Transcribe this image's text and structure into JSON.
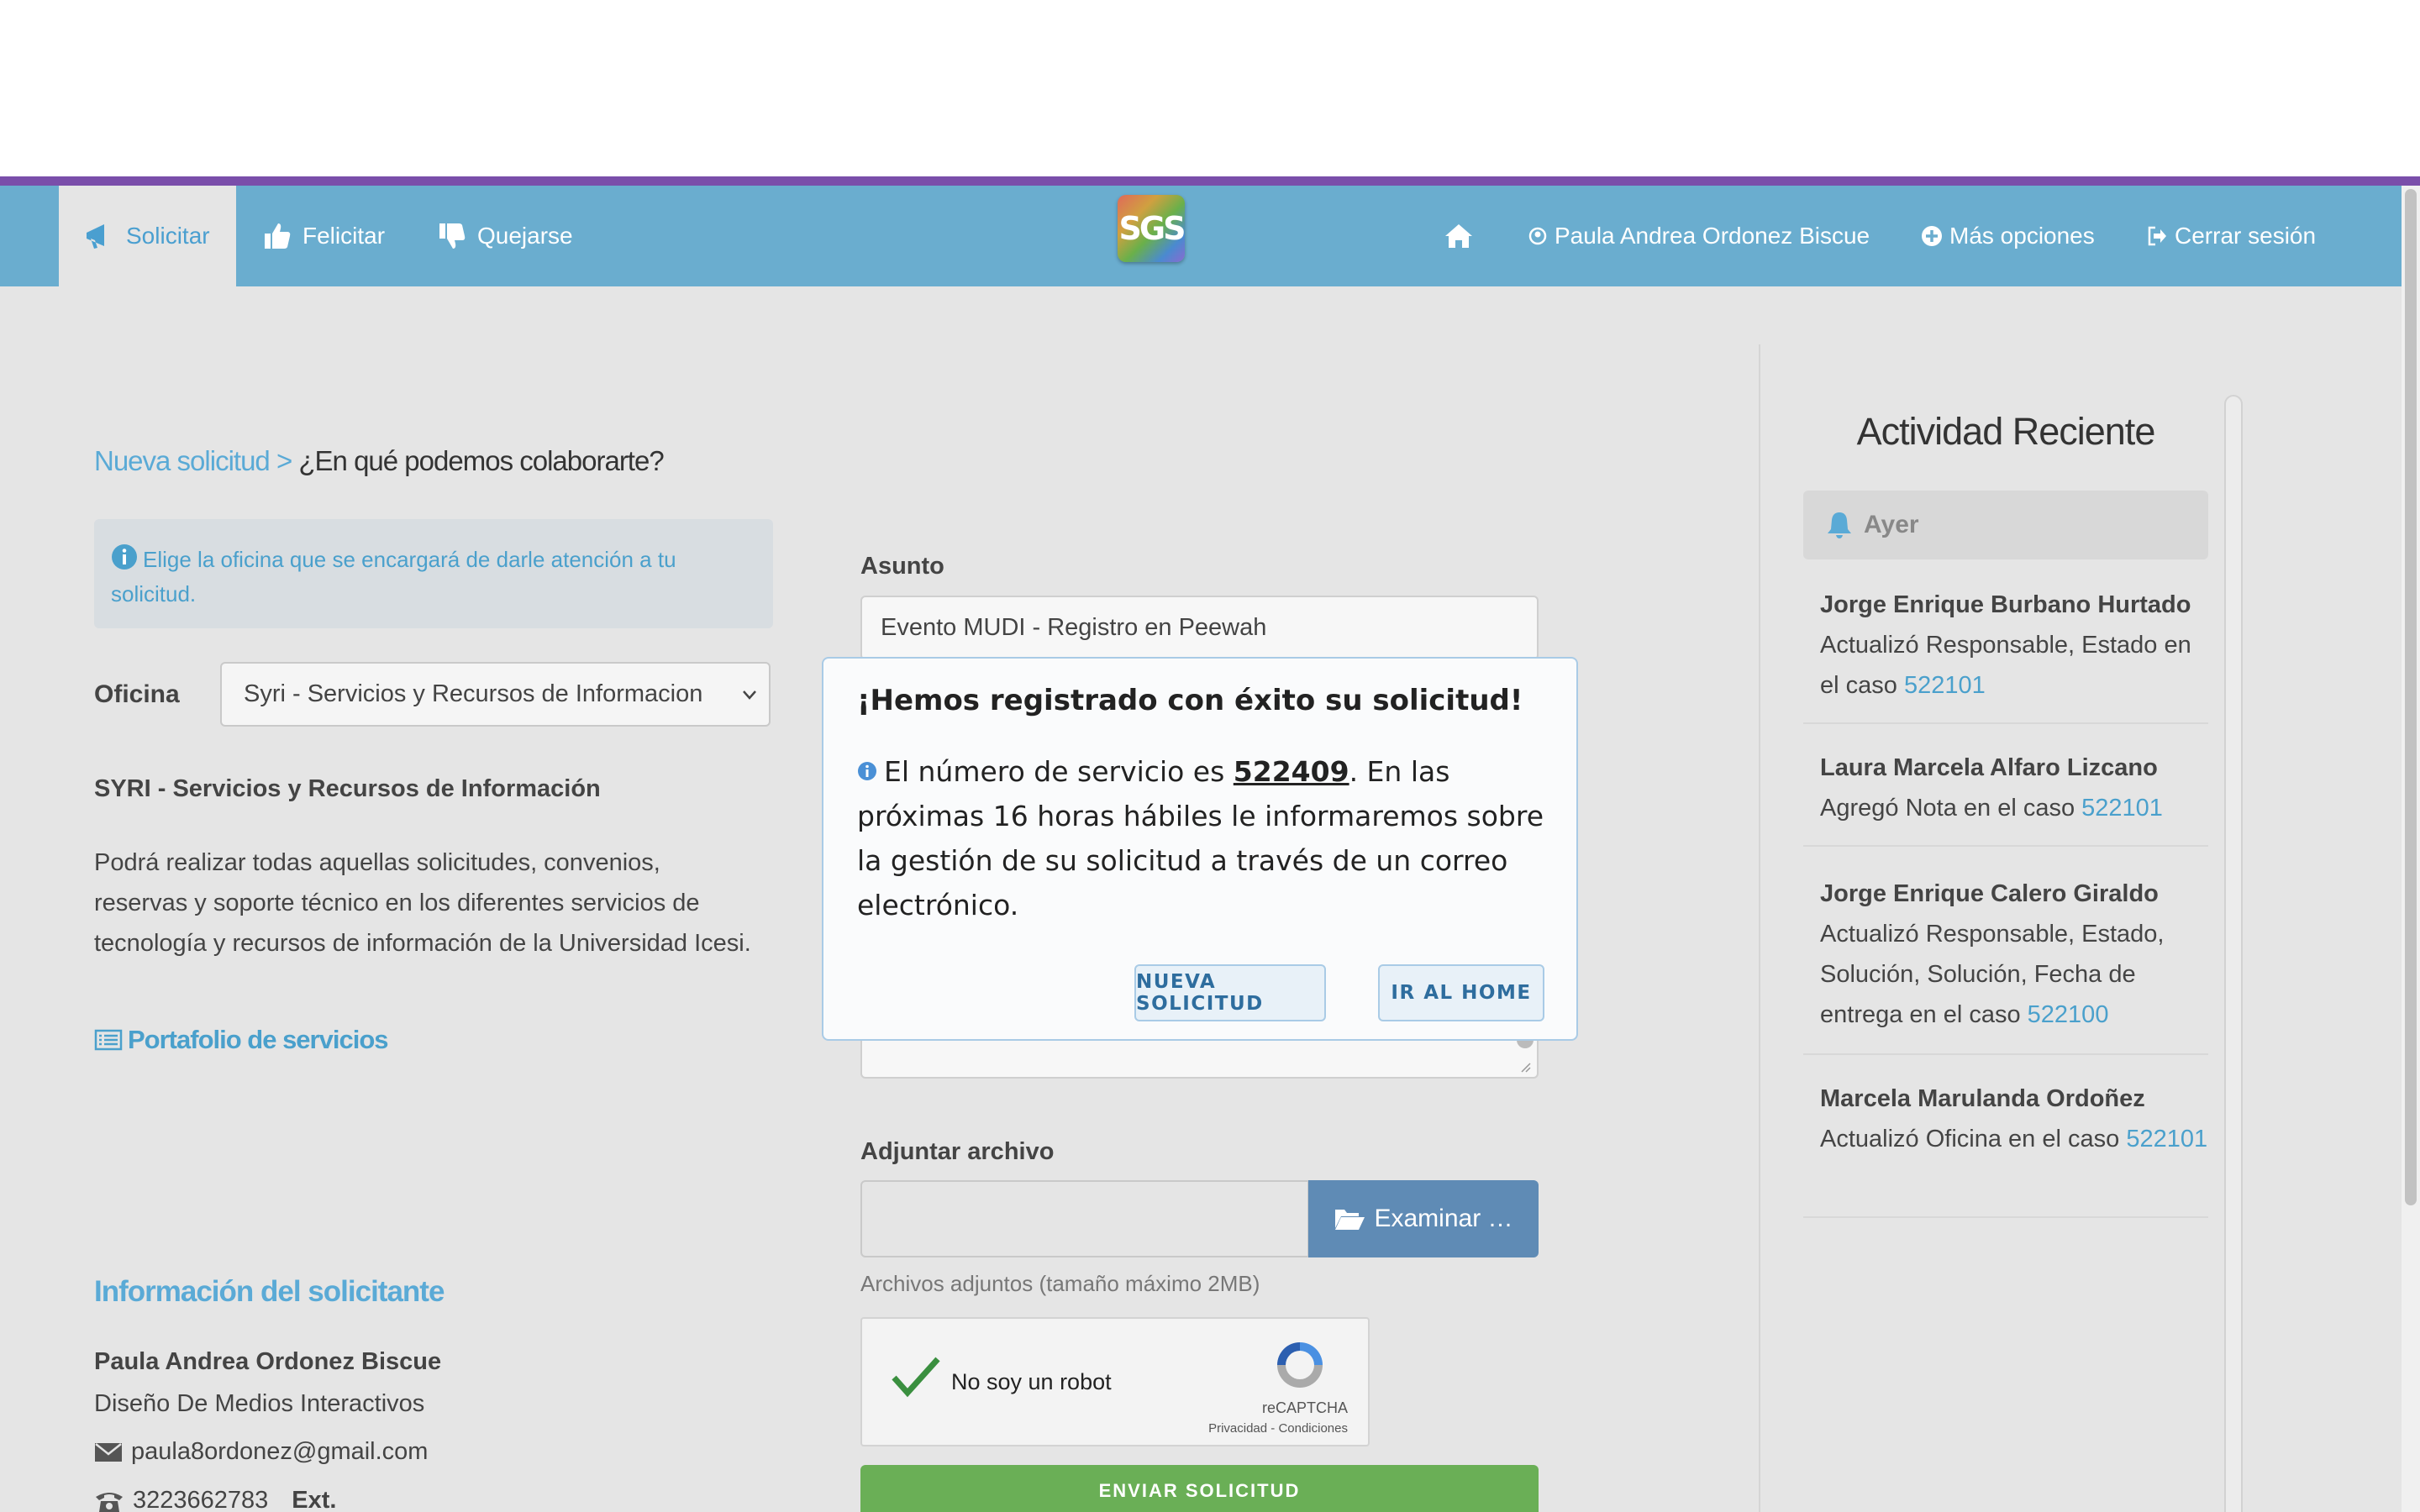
{
  "nav": {
    "solicitar": "Solicitar",
    "felicitar": "Felicitar",
    "quejarse": "Quejarse",
    "logo": "SGS",
    "user": "Paula Andrea Ordonez Biscue",
    "more": "Más opciones",
    "logout": "Cerrar sesión"
  },
  "breadcrumb": {
    "link": "Nueva solicitud > ",
    "current": "¿En qué podemos colaborarte?"
  },
  "info_box": "Elige la oficina que se encargará de darle atención a tu solicitud.",
  "oficina": {
    "label": "Oficina",
    "selected": "Syri - Servicios y Recursos de Informacion",
    "name": "SYRI - Servicios y Recursos de Información",
    "description": "Podrá realizar todas aquellas solicitudes, convenios, reservas y soporte técnico en los diferentes servicios de tecnología y recursos de información de la Universidad Icesi.",
    "portafolio": "Portafolio de servicios"
  },
  "solicitante": {
    "title": "Información del solicitante",
    "name": "Paula Andrea Ordonez Biscue",
    "area": "Diseño De Medios Interactivos",
    "email": "paula8ordonez@gmail.com",
    "phone": "3223662783",
    "ext_label": "Ext."
  },
  "form": {
    "asunto_label": "Asunto",
    "asunto_value": "Evento MUDI - Registro en Peewah",
    "adjuntar_label": "Adjuntar archivo",
    "examinar": "Examinar …",
    "file_help": "Archivos adjuntos (tamaño máximo 2MB)",
    "captcha_label": "No soy un robot",
    "captcha_brand": "reCAPTCHA",
    "captcha_links": "Privacidad - Condiciones",
    "submit": "ENVIAR SOLICITUD"
  },
  "modal": {
    "title": "¡Hemos registrado con éxito su solicitud!",
    "body_before": "El número de servicio es ",
    "number": "522409",
    "body_after": ". En las próximas 16 horas hábiles le informaremos sobre la gestión de su solicitud a través de un correo electrónico.",
    "btn_nueva": "NUEVA SOLICITUD",
    "btn_home": "IR AL HOME"
  },
  "activity": {
    "title": "Actividad Reciente",
    "group": "Ayer",
    "items": [
      {
        "who": "Jorge Enrique Burbano Hurtado",
        "what": "Actualizó Responsable, Estado en el caso ",
        "case": "522101"
      },
      {
        "who": "Laura Marcela Alfaro Lizcano",
        "what": "Agregó Nota en el caso ",
        "case": "522101"
      },
      {
        "who": "Jorge Enrique Calero Giraldo",
        "what": "Actualizó Responsable, Estado, Solución, Solución, Fecha de entrega en el caso ",
        "case": "522100"
      },
      {
        "who": "Marcela Marulanda Ordoñez",
        "what": "Actualizó Oficina en el caso ",
        "case": "522101"
      }
    ]
  },
  "colors": {
    "navbar": "#6aadcf",
    "accent_bar": "#7a4eaa",
    "link": "#4aa0cc",
    "submit": "#6aaf56",
    "file_button": "#5f8bb5"
  },
  "icons": [
    "megaphone-icon",
    "thumbs-up-icon",
    "thumbs-down-icon",
    "home-icon",
    "user-icon",
    "plus-circle-icon",
    "logout-icon",
    "info-icon",
    "chevron-down-icon",
    "list-icon",
    "envelope-icon",
    "phone-icon",
    "folder-open-icon",
    "bell-icon",
    "checkmark-icon",
    "recaptcha-icon",
    "resize-grip-icon"
  ]
}
